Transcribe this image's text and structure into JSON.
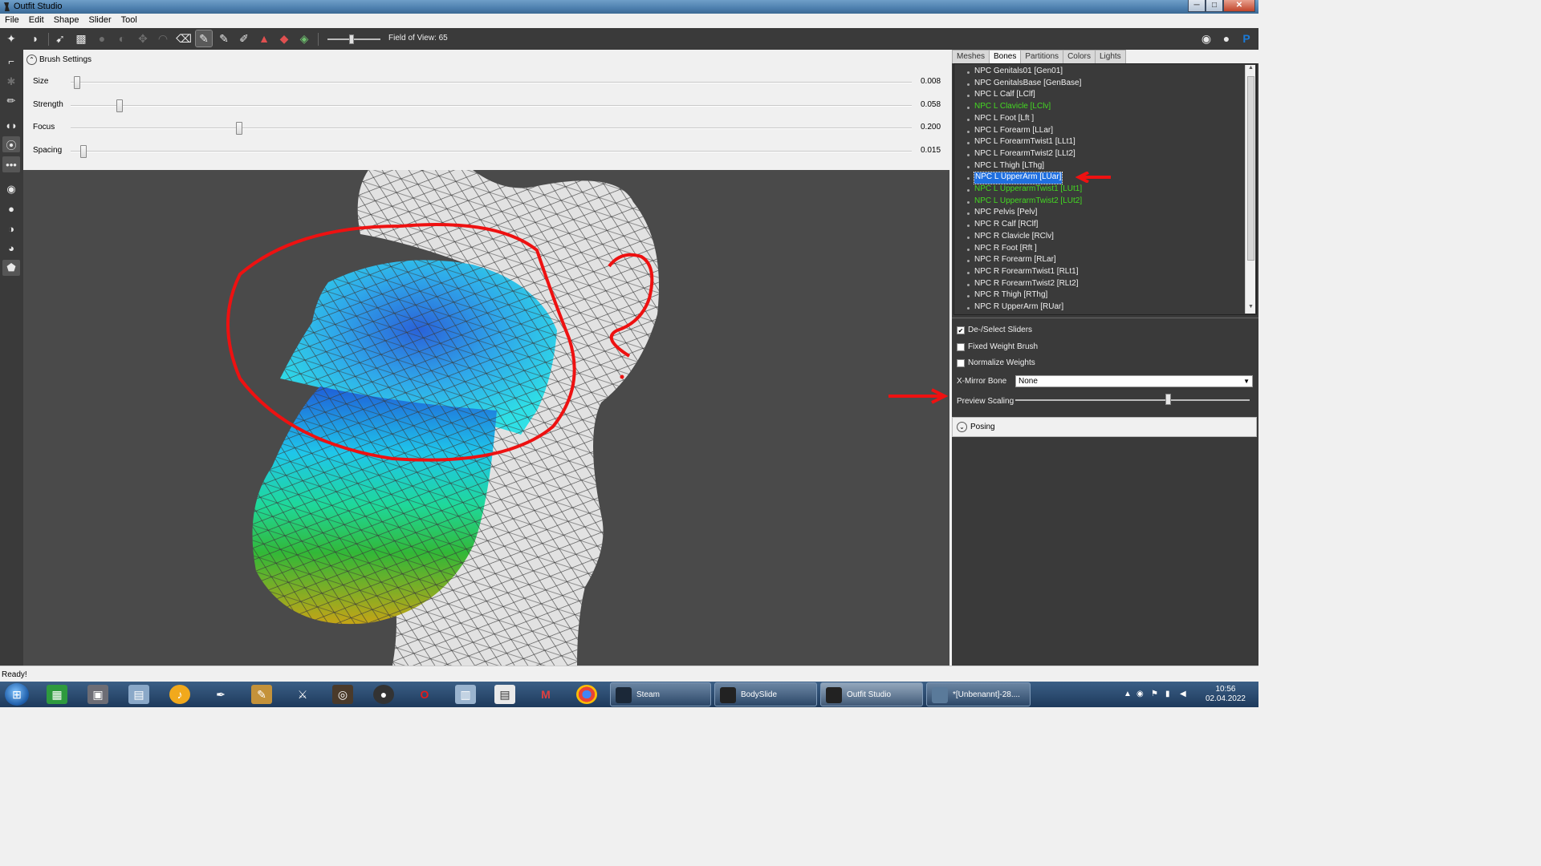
{
  "window": {
    "title": "Outfit Studio",
    "min_label": "─",
    "max_label": "□",
    "close_label": "✕"
  },
  "menu": [
    "File",
    "Edit",
    "Shape",
    "Slider",
    "Tool"
  ],
  "toolbar": {
    "fov_label": "Field of View: 65",
    "fov_value": 65
  },
  "brush": {
    "header": "Brush Settings",
    "rows": [
      {
        "label": "Size",
        "value": "0.008",
        "pos": 0.008
      },
      {
        "label": "Strength",
        "value": "0.058",
        "pos": 0.058
      },
      {
        "label": "Focus",
        "value": "0.200",
        "pos": 0.2
      },
      {
        "label": "Spacing",
        "value": "0.015",
        "pos": 0.015
      }
    ]
  },
  "tabs": [
    "Meshes",
    "Bones",
    "Partitions",
    "Colors",
    "Lights"
  ],
  "active_tab": "Bones",
  "bones": [
    {
      "name": "NPC Genitals01 [Gen01]",
      "state": "normal"
    },
    {
      "name": "NPC GenitalsBase [GenBase]",
      "state": "normal"
    },
    {
      "name": "NPC L Calf [LClf]",
      "state": "normal"
    },
    {
      "name": "NPC L Clavicle [LClv]",
      "state": "green"
    },
    {
      "name": "NPC L Foot [Lft ]",
      "state": "normal"
    },
    {
      "name": "NPC L Forearm [LLar]",
      "state": "normal"
    },
    {
      "name": "NPC L ForearmTwist1 [LLt1]",
      "state": "normal"
    },
    {
      "name": "NPC L ForearmTwist2 [LLt2]",
      "state": "normal"
    },
    {
      "name": "NPC L Thigh [LThg]",
      "state": "normal"
    },
    {
      "name": "NPC L UpperArm [LUar]",
      "state": "selected"
    },
    {
      "name": "NPC L UpperarmTwist1 [LUt1]",
      "state": "green"
    },
    {
      "name": "NPC L UpperarmTwist2 [LUt2]",
      "state": "green"
    },
    {
      "name": "NPC Pelvis [Pelv]",
      "state": "normal"
    },
    {
      "name": "NPC R Calf [RClf]",
      "state": "normal"
    },
    {
      "name": "NPC R Clavicle [RClv]",
      "state": "normal"
    },
    {
      "name": "NPC R Foot [Rft ]",
      "state": "normal"
    },
    {
      "name": "NPC R Forearm [RLar]",
      "state": "normal"
    },
    {
      "name": "NPC R ForearmTwist1 [RLt1]",
      "state": "normal"
    },
    {
      "name": "NPC R ForearmTwist2 [RLt2]",
      "state": "normal"
    },
    {
      "name": "NPC R Thigh [RThg]",
      "state": "normal"
    },
    {
      "name": "NPC R UpperArm [RUar]",
      "state": "normal"
    }
  ],
  "options": {
    "deselect_sliders": {
      "label": "De-/Select Sliders",
      "checked": true
    },
    "fixed_weight_brush": {
      "label": "Fixed Weight Brush",
      "checked": false
    },
    "normalize_weights": {
      "label": "Normalize Weights",
      "checked": false
    },
    "x_mirror_label": "X-Mirror Bone",
    "x_mirror_value": "None",
    "preview_scaling_label": "Preview Scaling",
    "preview_scaling_value": 0.65,
    "posing_label": "Posing"
  },
  "status": "Ready!",
  "taskbar": {
    "tasks": [
      "Steam",
      "BodySlide",
      "Outfit Studio",
      "*[Unbenannt]-28...."
    ],
    "time": "10:56",
    "date": "02.04.2022"
  },
  "colors": {
    "dark_panel": "#3a3a3a",
    "viewport_bg": "#4a4a4a",
    "selection": "#1f6fe0",
    "green_bone": "#44d822",
    "annotation_red": "#ee1111"
  }
}
